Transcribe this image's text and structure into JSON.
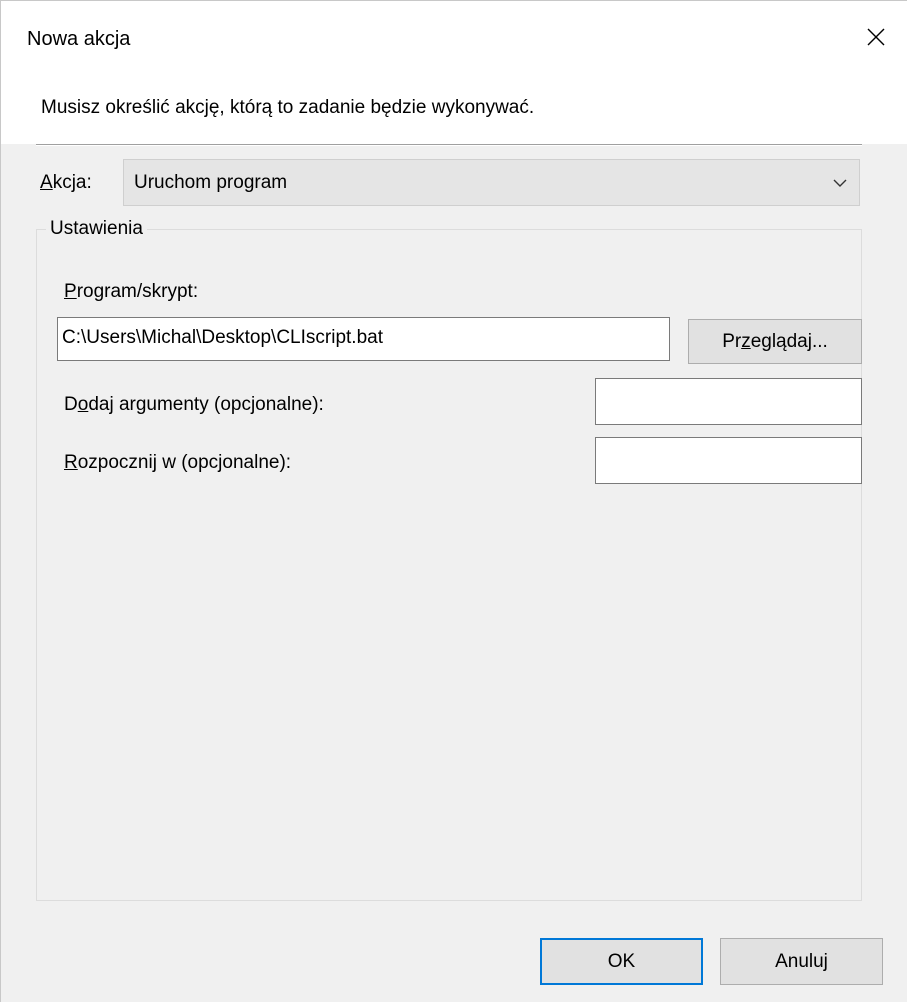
{
  "window": {
    "title": "Nowa akcja",
    "instruction": "Musisz określić akcję, którą to zadanie będzie wykonywać."
  },
  "action": {
    "label_accel": "A",
    "label_rest": "kcja:",
    "selected": "Uruchom program"
  },
  "settings": {
    "legend": "Ustawienia",
    "program_label_accel": "P",
    "program_label_rest": "rogram/skrypt:",
    "program_value": "C:\\Users\\Michal\\Desktop\\CLIscript.bat",
    "browse_pre": "Pr",
    "browse_accel": "z",
    "browse_post": "eglądaj...",
    "args_label_pre": "D",
    "args_label_accel": "o",
    "args_label_post": "daj argumenty (opcjonalne):",
    "args_value": "",
    "start_label_accel": "R",
    "start_label_rest": "ozpocznij w (opcjonalne):",
    "start_value": ""
  },
  "buttons": {
    "ok": "OK",
    "cancel": "Anuluj"
  },
  "icons": {
    "close": "close-icon",
    "dropdown": "chevron-down-icon"
  },
  "colors": {
    "accent": "#0078d7",
    "dialog_bg": "#f0f0f0",
    "button_bg": "#e1e1e1"
  }
}
